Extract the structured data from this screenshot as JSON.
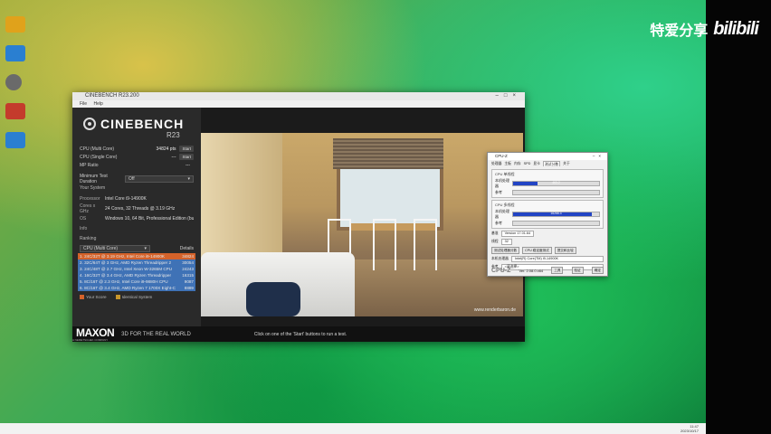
{
  "watermark": {
    "text": "特爱分享",
    "logo": "bilibili"
  },
  "desktop": {
    "icons": [
      {
        "label": "",
        "icon": "app-icon"
      },
      {
        "label": "",
        "icon": "folder-icon"
      },
      {
        "label": "",
        "icon": "app-icon"
      },
      {
        "label": "",
        "icon": "app-icon"
      },
      {
        "label": "",
        "icon": "app-icon"
      }
    ]
  },
  "cinebench": {
    "window_title": "CINEBENCH R23.200",
    "menu": [
      "File",
      "Help"
    ],
    "brand": "CINEBENCH",
    "version": "R23",
    "tests": [
      {
        "label": "CPU (Multi Core)",
        "value": "34824 pts",
        "button": "Start"
      },
      {
        "label": "CPU (Single Core)",
        "value": "---",
        "button": "Start"
      },
      {
        "label": "MP Ratio",
        "value": "---",
        "button": ""
      }
    ],
    "min_duration_label": "Minimum Test Duration",
    "min_duration_value": "Off",
    "your_system": "Your System",
    "system": [
      {
        "k": "Processor",
        "v": "Intel Core i9-14900K"
      },
      {
        "k": "Cores x GHz",
        "v": "24 Cores, 32 Threads @ 3.19 GHz"
      },
      {
        "k": "OS",
        "v": "Windows 10, 64 Bit, Professional Edition (build 2"
      },
      {
        "k": "Info",
        "v": ""
      }
    ],
    "ranking_label": "Ranking",
    "ranking_select": "CPU (Multi Core)",
    "details_label": "Details",
    "ranking": [
      {
        "t": "1. 24C/32T @ 3.19 GHz, Intel Core i9-14900K",
        "s": "34824",
        "kind": "me"
      },
      {
        "t": "2. 32C/64T @ 3 GHz, AMD Ryzen Threadripper 2",
        "s": "30054",
        "kind": "b"
      },
      {
        "t": "3. 24C/48T @ 2.7 GHz, Intel Xeon W-3265M CPU",
        "s": "24243",
        "kind": "b"
      },
      {
        "t": "4. 16C/32T @ 3.4 GHz, AMD Ryzen Threadripper",
        "s": "16315",
        "kind": "b"
      },
      {
        "t": "5. 8C/16T @ 2.3 GHz, Intel Core i9-9880H CPU",
        "s": "9087",
        "kind": "b"
      },
      {
        "t": "6. 8C/16T @ 3.4 GHz, AMD Ryzen 7 1700X Eight-C",
        "s": "8889",
        "kind": "b"
      }
    ],
    "legend": [
      {
        "label": "Your Score",
        "color": "#d4622a"
      },
      {
        "label": "Identical System",
        "color": "#c7962c"
      }
    ],
    "render_credit": "www.renderbaron.de",
    "footer_brand": "MAXON",
    "footer_sub": "A NEMETSCHEK COMPANY",
    "footer_tag": "3D FOR THE REAL WORLD",
    "footer_hint": "Click on one of the 'Start' buttons to run a test."
  },
  "cpuz": {
    "title": "CPU-Z",
    "tabs": [
      "处理器",
      "主板",
      "内存",
      "SPD",
      "显卡",
      "测试分数",
      "关于"
    ],
    "active_tab": 5,
    "single": {
      "header": "CPU 单线程",
      "this_label": "本机处理器",
      "ref_label": "参考",
      "value": "463.2",
      "fill": 0.28
    },
    "multi": {
      "header": "CPU 多线程",
      "this_label": "本机处理器",
      "ref_label": "参考",
      "value": "16266.4",
      "fill": 0.92
    },
    "bench_label": "基准",
    "bench_value": "Version 17.01.64",
    "threads_label": "线程",
    "threads_value": "32",
    "btn_bench": "测试处理器分数",
    "btn_stress": "CPU 稳定度测试",
    "btn_submit": "提交和比较",
    "this_cpu_label": "本机处理器",
    "this_cpu_value": "Intel(R) Core(TM) i9-14900K",
    "ref_label": "参考",
    "ref_value": "<请选择>",
    "footer_logo": "CPU-Z",
    "footer_ver": "Ver. 2.08.0.x64",
    "footer_tools": "工具",
    "footer_validate": "验证",
    "footer_ok": "确定"
  },
  "taskbar": {
    "time": "11:47",
    "date": "2023/10/17"
  }
}
